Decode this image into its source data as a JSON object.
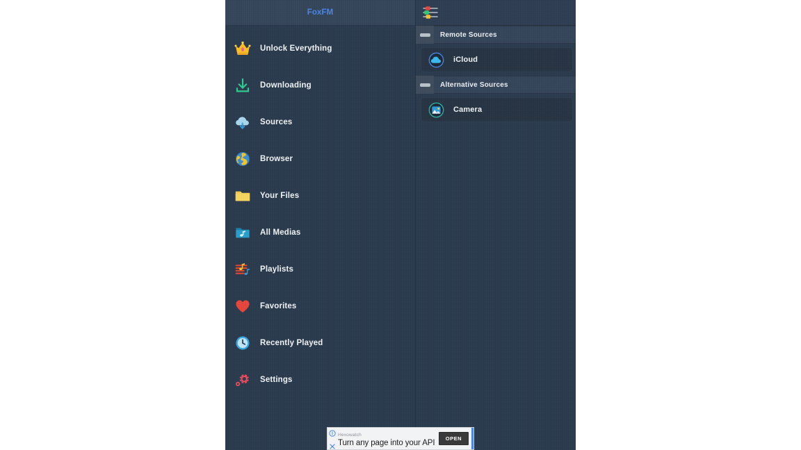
{
  "app": {
    "background_color": "#2b3b4e",
    "accent_color": "#4a86e8"
  },
  "sidebar": {
    "header": {
      "title": "FoxFM"
    },
    "items": [
      {
        "label": "Unlock Everything",
        "icon": "crown-icon"
      },
      {
        "label": "Downloading",
        "icon": "download-arrow-icon"
      },
      {
        "label": "Sources",
        "icon": "cloud-download-icon"
      },
      {
        "label": "Browser",
        "icon": "globe-icon"
      },
      {
        "label": "Your Files",
        "icon": "folder-icon"
      },
      {
        "label": "All Medias",
        "icon": "music-folder-icon"
      },
      {
        "label": "Playlists",
        "icon": "playlist-icon"
      },
      {
        "label": "Favorites",
        "icon": "heart-icon"
      },
      {
        "label": "Recently Played",
        "icon": "clock-icon"
      },
      {
        "label": "Settings",
        "icon": "gear-icon"
      }
    ]
  },
  "right_panel": {
    "toolbar": {
      "equalizer_icon": "equalizer-sliders-icon"
    },
    "groups": [
      {
        "title": "Remote Sources",
        "grip_icon": "drag-handle-icon",
        "sources": [
          {
            "label": "iCloud",
            "icon": "icloud-icon"
          }
        ]
      },
      {
        "title": "Alternative Sources",
        "grip_icon": "drag-handle-icon",
        "sources": [
          {
            "label": "Camera",
            "icon": "camera-photo-icon"
          }
        ]
      }
    ]
  },
  "ad_banner": {
    "brand": "Hexowatch",
    "headline": "Turn any page into your API",
    "cta_label": "OPEN",
    "info_icon": "info-circle-icon",
    "close_icon": "close-x-icon"
  }
}
